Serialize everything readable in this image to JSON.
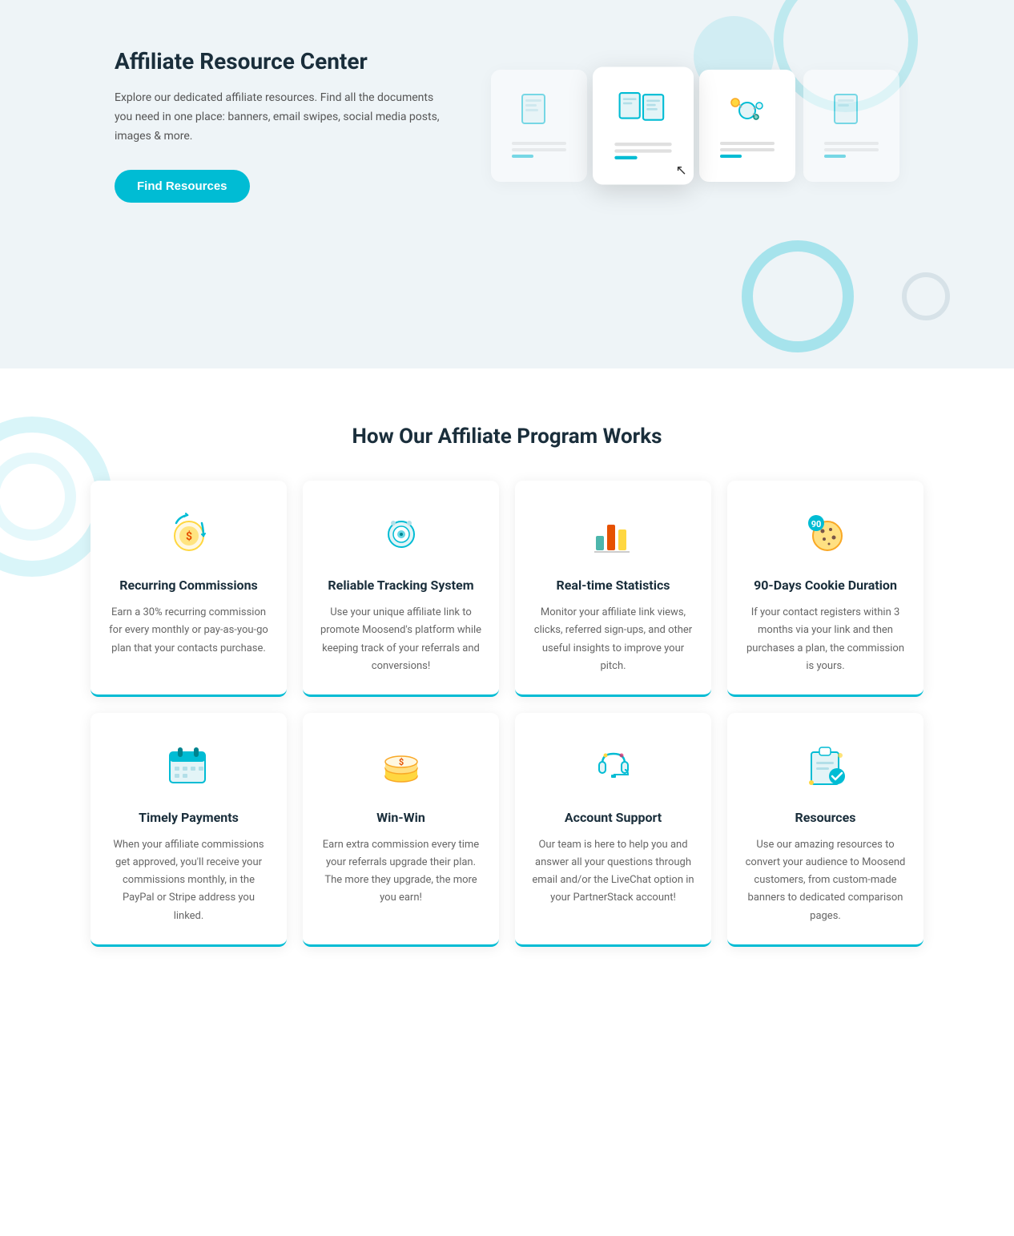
{
  "hero": {
    "title": "Affiliate Resource Center",
    "description": "Explore our dedicated affiliate resources. Find all the documents you need in one place: banners, email swipes, social media posts, images & more.",
    "cta_label": "Find Resources"
  },
  "how": {
    "title": "How Our Affiliate Program Works",
    "cards_row1": [
      {
        "id": "recurring",
        "title": "Recurring Commissions",
        "description": "Earn a 30% recurring commission for every monthly or pay-as-you-go plan that your contacts purchase."
      },
      {
        "id": "tracking",
        "title": "Reliable Tracking System",
        "description": "Use your unique affiliate link to promote Moosend's platform while keeping track of your referrals and conversions!"
      },
      {
        "id": "statistics",
        "title": "Real-time Statistics",
        "description": "Monitor your affiliate link views, clicks, referred sign-ups, and other useful insights to improve your pitch."
      },
      {
        "id": "cookie",
        "title": "90-Days Cookie Duration",
        "description": "If your contact registers within 3 months via your link and then purchases a plan, the commission is yours."
      }
    ],
    "cards_row2": [
      {
        "id": "payments",
        "title": "Timely Payments",
        "description": "When your affiliate commissions get approved, you'll receive your commissions monthly, in the PayPal or Stripe address you linked."
      },
      {
        "id": "winwin",
        "title": "Win-Win",
        "description": "Earn extra commission every time your referrals upgrade their plan. The more they upgrade, the more you earn!"
      },
      {
        "id": "support",
        "title": "Account Support",
        "description": "Our team is here to help you and answer all your questions through email and/or the LiveChat option in your PartnerStack account!"
      },
      {
        "id": "resources",
        "title": "Resources",
        "description": "Use our amazing resources to convert your audience to Moosend customers, from custom-made banners to dedicated comparison pages."
      }
    ]
  }
}
